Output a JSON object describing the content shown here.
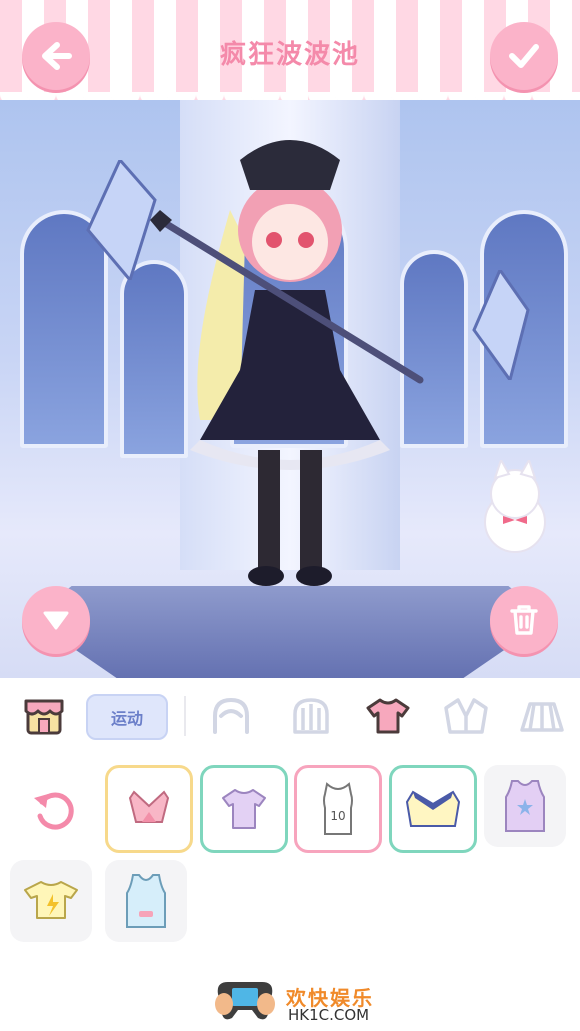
{
  "header": {
    "title": "疯狂波波池",
    "back_icon": "arrow-left-icon",
    "confirm_icon": "check-icon"
  },
  "scene": {
    "collapse_icon": "triangle-down-icon",
    "trash_icon": "trash-icon"
  },
  "toolbar": {
    "shop_icon": "shop-icon",
    "category_tag": "运动",
    "categories": [
      "hair-front-icon",
      "hair-back-icon",
      "top-icon",
      "jacket-icon",
      "skirt-icon"
    ]
  },
  "items": {
    "reset_icon": "undo-icon",
    "slots": [
      {
        "name": "halter-top",
        "selected_color": "#f7d98b"
      },
      {
        "name": "lilac-tshirt",
        "selected_color": "#7fd6bd"
      },
      {
        "name": "jersey-10",
        "selected_color": "#f7a4bd",
        "number": "10"
      },
      {
        "name": "cheer-top",
        "selected_color": "#7fd6bd"
      },
      {
        "name": "star-tank",
        "selected_color": ""
      },
      {
        "name": "yellow-lightning-tee",
        "selected_color": ""
      },
      {
        "name": "blue-vest",
        "selected_color": ""
      }
    ]
  },
  "footer": {
    "brand_cn": "欢快娱乐",
    "brand_en": "HK1C.COM"
  }
}
